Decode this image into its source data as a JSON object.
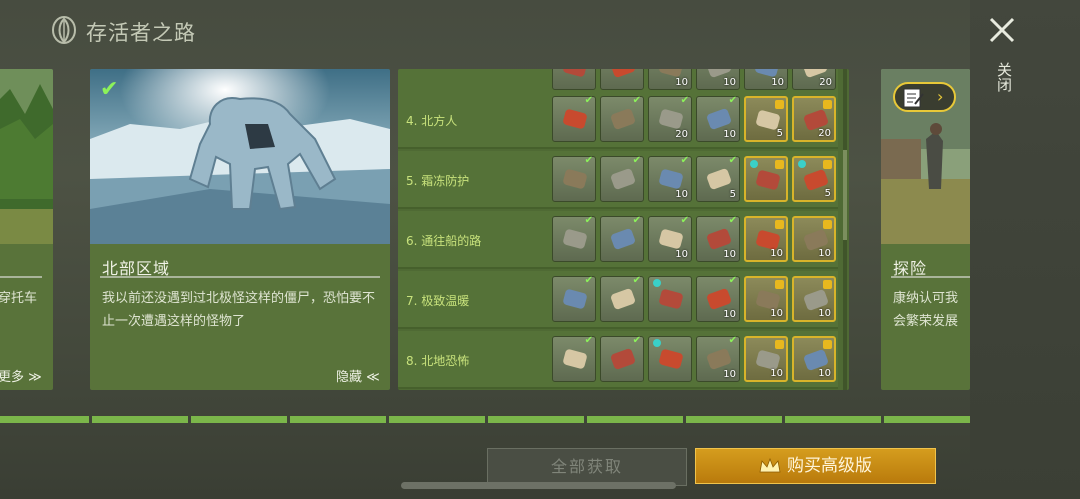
{
  "header": {
    "title": "存活者之路",
    "logo_icon": "leaf-emblem-icon"
  },
  "close": {
    "label": "关闭",
    "icon": "close-icon"
  },
  "cards": {
    "left": {
      "desc_fragment": "穿托车",
      "toggle": "更多 ≫"
    },
    "main": {
      "completed": true,
      "title": "北部区域",
      "desc": "我以前还没遇到过北极怪这样的僵尸，恐怕要不止一次遭遇这样的怪物了",
      "toggle": "隐藏 ≪"
    },
    "right": {
      "title": "探险",
      "desc_line1": "康纳认可我",
      "desc_line2": "会繁荣发展"
    }
  },
  "rows": [
    {
      "label": "",
      "slots": [
        {
          "icon": "crate-icon",
          "qty": ""
        },
        {
          "icon": "parts-icon",
          "qty": ""
        },
        {
          "icon": "hide-icon",
          "qty": "10"
        },
        {
          "icon": "scrap-icon",
          "qty": "10"
        },
        {
          "icon": "rope-icon",
          "qty": "10"
        },
        {
          "icon": "planks-icon",
          "qty": "20"
        }
      ]
    },
    {
      "label": "4. 北方人",
      "slots": [
        {
          "icon": "medkit-icon",
          "qty": "",
          "check": true
        },
        {
          "icon": "flare-gun-icon",
          "qty": "",
          "check": true
        },
        {
          "icon": "stone-icon",
          "qty": "20",
          "check": true
        },
        {
          "icon": "cloth-icon",
          "qty": "10",
          "check": true
        },
        {
          "icon": "bottle-icon",
          "qty": "5",
          "premium": true
        },
        {
          "icon": "boards-icon",
          "qty": "20",
          "premium": true
        }
      ]
    },
    {
      "label": "5. 霜冻防护",
      "slots": [
        {
          "icon": "armor-vest-icon",
          "qty": "",
          "check": true
        },
        {
          "icon": "helmet-icon",
          "qty": "",
          "check": true
        },
        {
          "icon": "metal-plate-icon",
          "qty": "10",
          "check": true
        },
        {
          "icon": "berries-icon",
          "qty": "5",
          "check": true
        },
        {
          "icon": "torch-icon",
          "qty": "",
          "premium": true,
          "info": true
        },
        {
          "icon": "backpack-icon",
          "qty": "5",
          "premium": true,
          "info": true
        }
      ]
    },
    {
      "label": "6. 通往船的路",
      "slots": [
        {
          "icon": "rifle-icon",
          "qty": "",
          "check": true
        },
        {
          "icon": "backpack-green-icon",
          "qty": "",
          "check": true
        },
        {
          "icon": "leather-icon",
          "qty": "10",
          "check": true
        },
        {
          "icon": "plank-icon",
          "qty": "10",
          "check": true
        },
        {
          "icon": "spring-icon",
          "qty": "10",
          "premium": true
        },
        {
          "icon": "ingot-icon",
          "qty": "10",
          "premium": true
        }
      ]
    },
    {
      "label": "7. 极致温暖",
      "slots": [
        {
          "icon": "knife-icon",
          "qty": "",
          "check": true
        },
        {
          "icon": "lamp-icon",
          "qty": "",
          "check": true
        },
        {
          "icon": "flare-icon",
          "qty": "",
          "info": true
        },
        {
          "icon": "ore-icon",
          "qty": "10",
          "check": true
        },
        {
          "icon": "medkit-red-icon",
          "qty": "10",
          "premium": true
        },
        {
          "icon": "copper-ingot-icon",
          "qty": "10",
          "premium": true
        }
      ]
    },
    {
      "label": "8. 北地恐怖",
      "slots": [
        {
          "icon": "pickaxe-icon",
          "qty": "",
          "check": true
        },
        {
          "icon": "sign-icon",
          "qty": "",
          "check": true
        },
        {
          "icon": "rifle-scope-icon",
          "qty": "",
          "info": true
        },
        {
          "icon": "steel-sheet-icon",
          "qty": "10",
          "check": true
        },
        {
          "icon": "torch-gold-icon",
          "qty": "10",
          "premium": true
        },
        {
          "icon": "pipes-icon",
          "qty": "10",
          "premium": true
        }
      ]
    }
  ],
  "buttons": {
    "get_all": "全部获取",
    "buy_premium": "购买高级版"
  },
  "colors": {
    "accent_green": "#7bb64a",
    "premium_gold": "#d59d1e"
  }
}
